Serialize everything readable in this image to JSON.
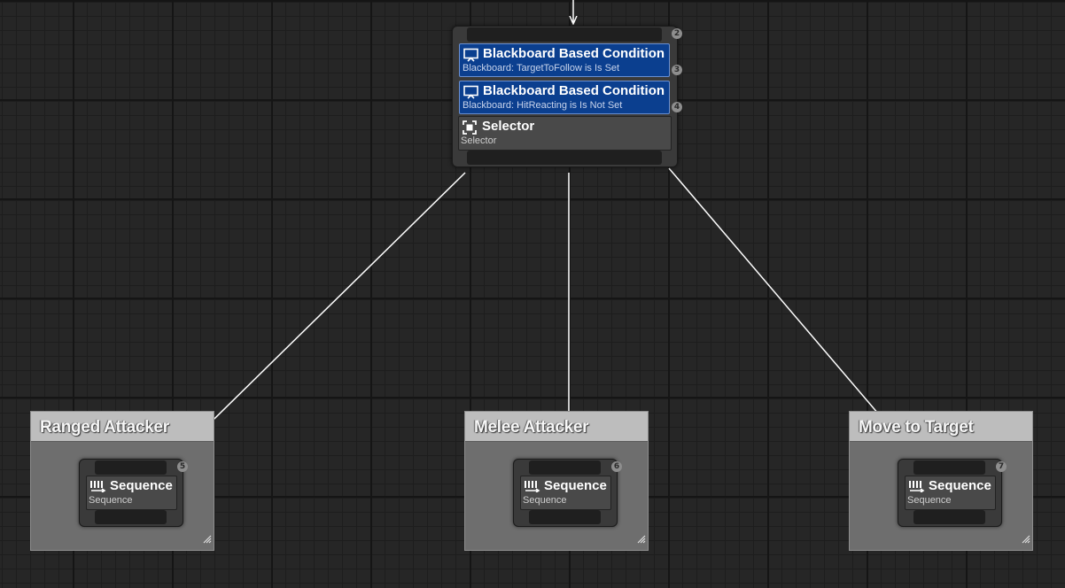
{
  "root_node": {
    "index": "2",
    "decorators": [
      {
        "title": "Blackboard Based Condition",
        "subtitle": "Blackboard: TargetToFollow is Is Set",
        "index": "3"
      },
      {
        "title": "Blackboard Based Condition",
        "subtitle": "Blackboard: HitReacting is Is Not Set",
        "index": "4"
      }
    ],
    "composite": {
      "title": "Selector",
      "subtitle": "Selector"
    }
  },
  "groups": [
    {
      "comment": "Ranged Attacker",
      "node_title": "Sequence",
      "node_subtitle": "Sequence",
      "index": "5"
    },
    {
      "comment": "Melee Attacker",
      "node_title": "Sequence",
      "node_subtitle": "Sequence",
      "index": "6"
    },
    {
      "comment": "Move to Target",
      "node_title": "Sequence",
      "node_subtitle": "Sequence",
      "index": "7"
    }
  ],
  "icons": {
    "decorator": "monitor-icon",
    "selector": "selector-icon",
    "sequence": "sequence-icon",
    "resize": "resize-grip-icon"
  },
  "colors": {
    "grid_bg": "#262626",
    "decorator": "#0b3f8f",
    "composite": "#494949",
    "comment_header": "#bdbdbd",
    "wire": "#ffffff"
  }
}
